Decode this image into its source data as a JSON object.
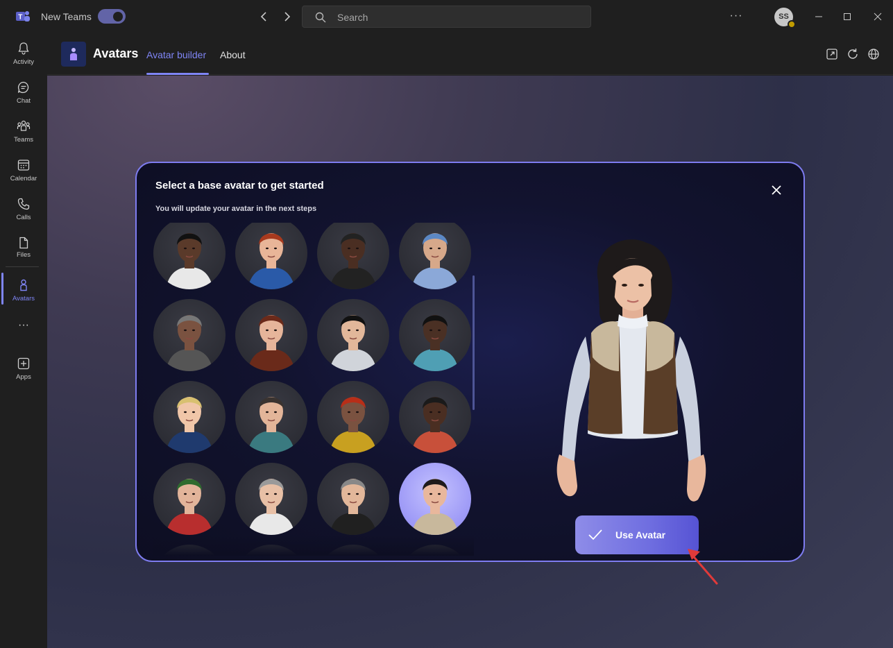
{
  "titlebar": {
    "app_name": "New Teams",
    "search_placeholder": "Search",
    "more": "···",
    "user_initials": "SS"
  },
  "rail": {
    "items": [
      {
        "label": "Activity",
        "icon": "bell-icon"
      },
      {
        "label": "Chat",
        "icon": "chat-icon"
      },
      {
        "label": "Teams",
        "icon": "teams-icon"
      },
      {
        "label": "Calendar",
        "icon": "calendar-icon"
      },
      {
        "label": "Calls",
        "icon": "phone-icon"
      },
      {
        "label": "Files",
        "icon": "file-icon"
      },
      {
        "label": "Avatars",
        "icon": "avatar-icon",
        "active": true
      },
      {
        "label": "Apps",
        "icon": "plus-square-icon"
      }
    ],
    "more": "···"
  },
  "app": {
    "title": "Avatars",
    "tabs": [
      {
        "label": "Avatar builder",
        "active": true
      },
      {
        "label": "About",
        "active": false
      }
    ]
  },
  "modal": {
    "title": "Select a base avatar to get started",
    "subtitle": "You will update your avatar in the next steps",
    "use_button": "Use Avatar"
  },
  "colors": {
    "accent": "#7f85f5",
    "modal_border": "#7e7cf0",
    "button": "#6f6ee0",
    "annotation_arrow": "#e03a3a"
  }
}
